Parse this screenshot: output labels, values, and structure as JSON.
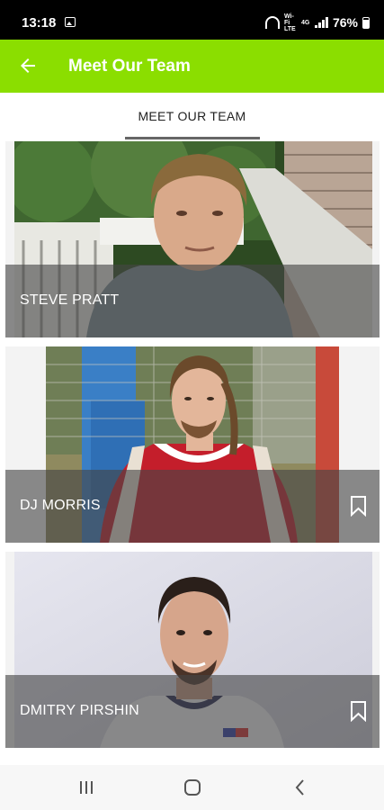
{
  "status_bar": {
    "time": "13:18",
    "wifi_label": "Wi-Fi LTE",
    "network_label": "4G",
    "battery": "76%",
    "battery_level": 0.76
  },
  "app_bar": {
    "title": "Meet Our Team",
    "back_icon": "arrow-left-icon"
  },
  "tabs": [
    {
      "label": "MEET OUR TEAM",
      "selected": true
    }
  ],
  "team": [
    {
      "name": "STEVE PRATT",
      "bookmark": false
    },
    {
      "name": "DJ MORRIS",
      "bookmark": true
    },
    {
      "name": "DMITRY PIRSHIN",
      "bookmark": true
    }
  ],
  "colors": {
    "app_bar": "#8bde00",
    "status_bar": "#000000",
    "overlay": "#464646"
  },
  "nav_bar": {
    "icons": [
      "recent-apps-icon",
      "home-icon",
      "back-icon"
    ]
  }
}
